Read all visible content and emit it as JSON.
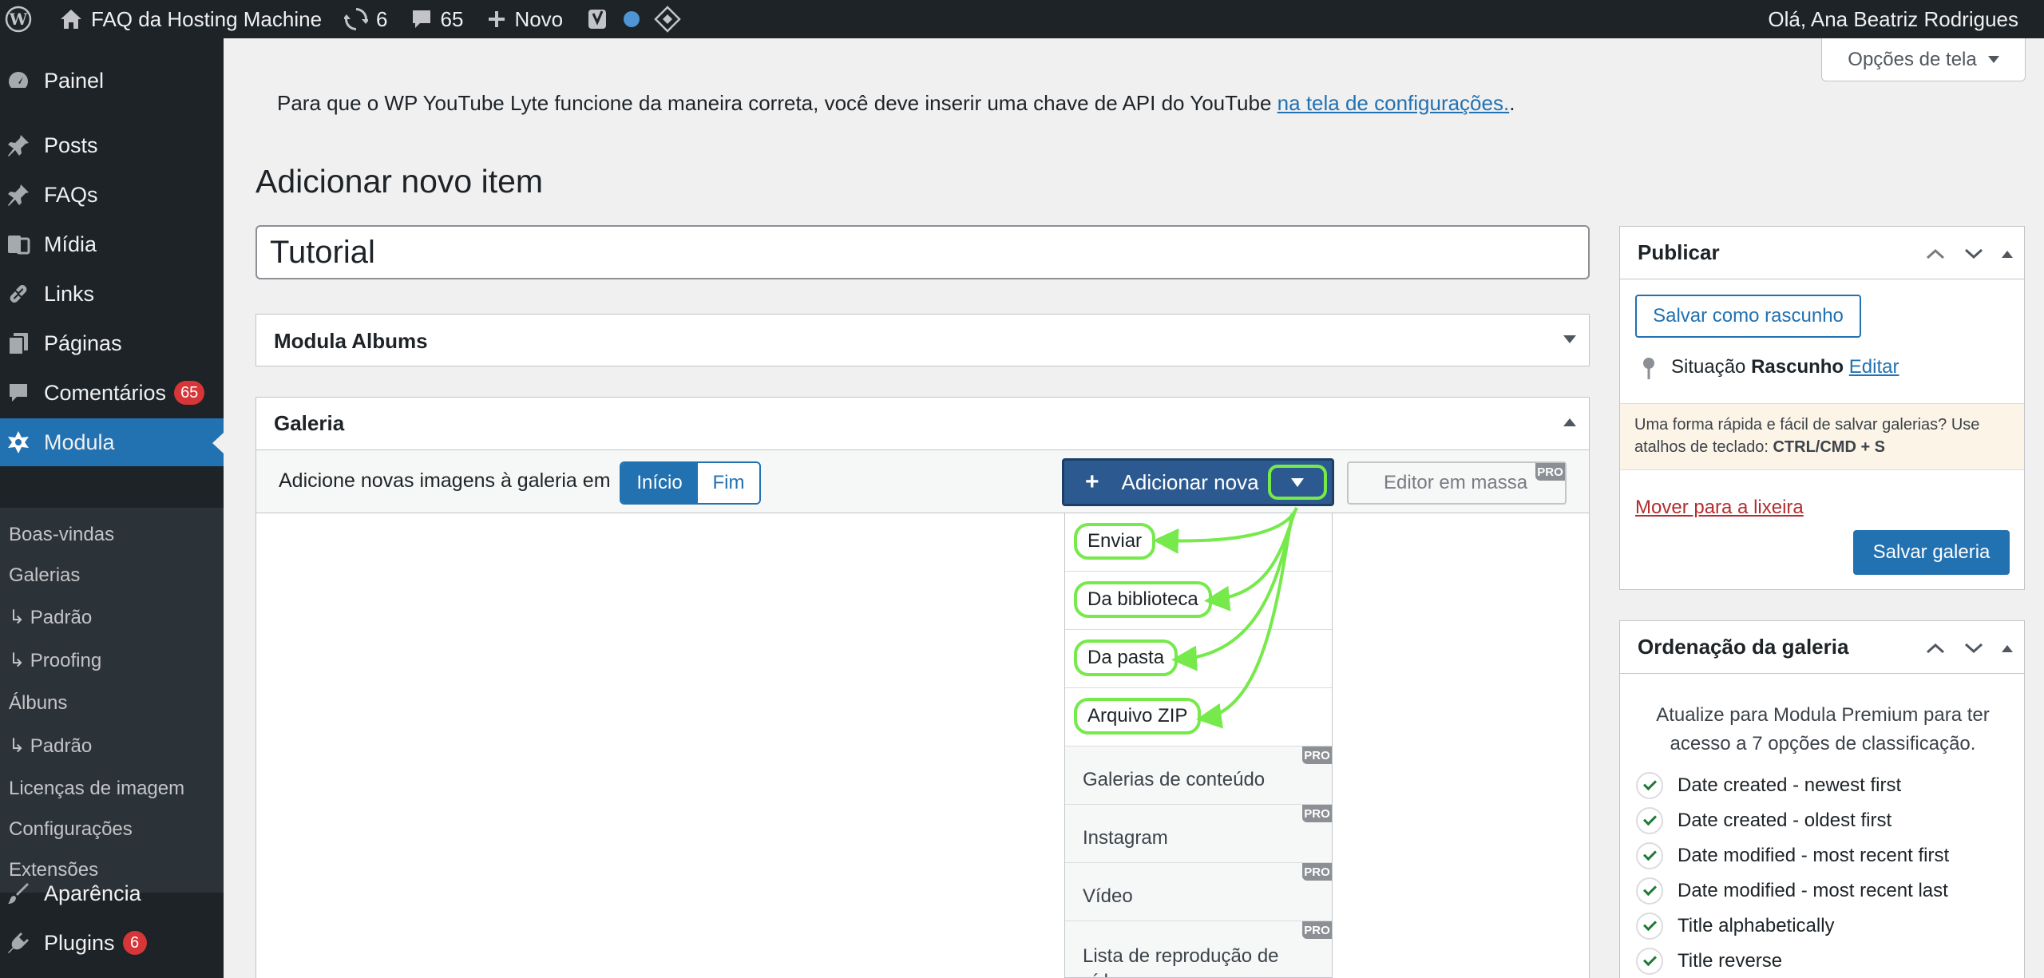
{
  "adminbar": {
    "site_name": "FAQ da Hosting Machine",
    "updates_count": "6",
    "comments_count": "65",
    "new_label": "Novo",
    "greeting": "Olá, Ana Beatriz Rodrigues"
  },
  "sidebar": {
    "items": [
      {
        "label": "Painel",
        "icon": "dashboard-icon"
      },
      {
        "label": "Posts",
        "icon": "pin-icon"
      },
      {
        "label": "FAQs",
        "icon": "pin-icon"
      },
      {
        "label": "Mídia",
        "icon": "media-icon"
      },
      {
        "label": "Links",
        "icon": "link-icon"
      },
      {
        "label": "Páginas",
        "icon": "pages-icon"
      },
      {
        "label": "Comentários",
        "icon": "comment-icon",
        "badge": "65"
      },
      {
        "label": "Modula",
        "icon": "modula-icon"
      },
      {
        "label": "Aparência",
        "icon": "brush-icon"
      },
      {
        "label": "Plugins",
        "icon": "plugin-icon",
        "badge": "6"
      }
    ],
    "submenu": [
      "Boas-vindas",
      "Galerias",
      "↳ Padrão",
      "↳ Proofing",
      "Álbuns",
      "↳ Padrão",
      "Licenças de imagem",
      "Configurações",
      "Extensões"
    ]
  },
  "screen_options": "Opções de tela",
  "notice": {
    "text": "Para que o WP YouTube Lyte funcione da maneira correta, você deve inserir uma chave de API do YouTube ",
    "link": "na tela de configurações.",
    "end": "."
  },
  "page_title": "Adicionar novo item",
  "title_value": "Tutorial",
  "albums_box": {
    "title": "Modula Albums"
  },
  "gallery_box": {
    "title": "Galeria",
    "add_label": "Adicione novas imagens à galeria em",
    "segment": [
      "Início",
      "Fim"
    ],
    "add_new": "Adicionar nova",
    "bulk_editor": "Editor em massa",
    "pro": "PRO",
    "dropdown": [
      "Enviar",
      "Da biblioteca",
      "Da pasta",
      "Arquivo ZIP",
      "Galerias de conteúdo",
      "Instagram",
      "Vídeo",
      "Lista de reprodução de vídeo"
    ]
  },
  "publish": {
    "title": "Publicar",
    "save_draft": "Salvar como rascunho",
    "status_label": "Situação",
    "status_value": "Rascunho",
    "edit": "Editar",
    "hint": "Uma forma rápida e fácil de salvar galerias? Use atalhos de teclado: ",
    "shortcut": "CTRL/CMD + S",
    "trash": "Mover para a lixeira",
    "save": "Salvar galeria"
  },
  "ordering": {
    "title": "Ordenação da galeria",
    "description": "Atualize para Modula Premium para ter acesso a 7 opções de classificação.",
    "options": [
      "Date created - newest first",
      "Date created - oldest first",
      "Date modified - most recent first",
      "Date modified - most recent last",
      "Title alphabetically",
      "Title reverse"
    ]
  },
  "colors": {
    "accent": "#2271b1",
    "highlight": "#76e94b",
    "adminbar": "#1d2327"
  }
}
